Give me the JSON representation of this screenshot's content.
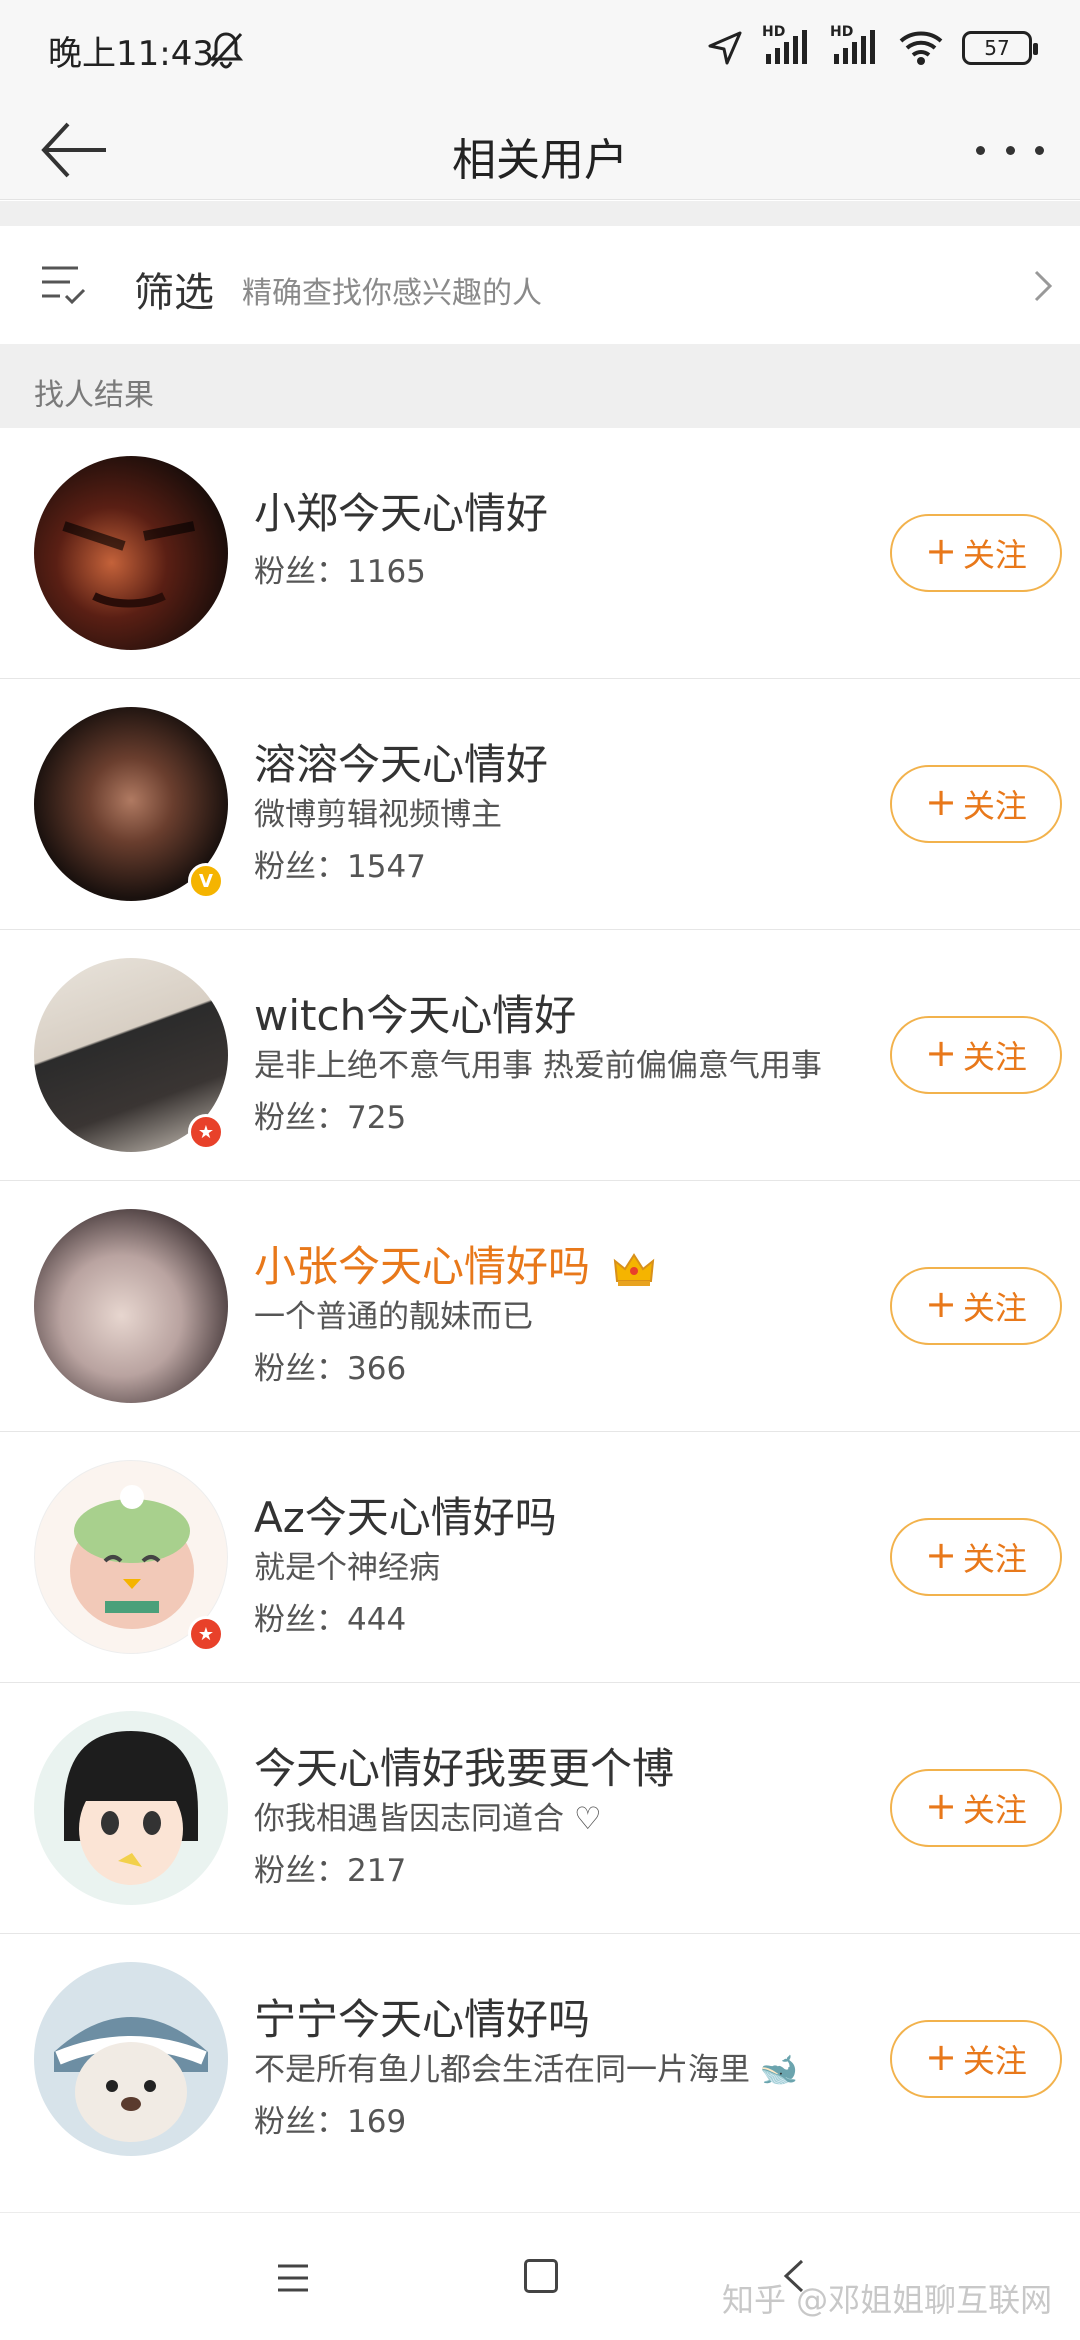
{
  "status": {
    "time": "晚上11:43",
    "hd1": "HD",
    "hd2": "HD",
    "battery": "57"
  },
  "header": {
    "title": "相关用户",
    "back_icon": "arrow-left-icon",
    "more_icon": "more-dots-icon"
  },
  "filter": {
    "label": "筛选",
    "hint": "精确查找你感兴趣的人"
  },
  "section": {
    "title": "找人结果"
  },
  "follow_label": "关注",
  "fans_prefix": "粉丝：",
  "users": [
    {
      "name": "小郑今天心情好",
      "bio": "",
      "fans": "1165"
    },
    {
      "name": "溶溶今天心情好",
      "bio": "微博剪辑视频博主",
      "fans": "1547",
      "badge": "V"
    },
    {
      "name": "witch今天心情好",
      "bio": "是非上绝不意气用事 热爱前偏偏意气用事",
      "fans": "725",
      "badge": "★"
    },
    {
      "name": "小张今天心情好吗",
      "bio": "一个普通的靓妹而已",
      "fans": "366"
    },
    {
      "name": "Az今天心情好吗",
      "bio": "就是个神经病",
      "fans": "444",
      "badge": "★"
    },
    {
      "name": "今天心情好我要更个博",
      "bio": "你我相遇皆因志同道合 ♡",
      "fans": "217"
    },
    {
      "name": "宁宁今天心情好吗",
      "bio": "不是所有鱼儿都会生活在同一片海里 🐋",
      "fans": "169"
    }
  ],
  "watermark": "知乎 @邓姐姐聊互联网"
}
